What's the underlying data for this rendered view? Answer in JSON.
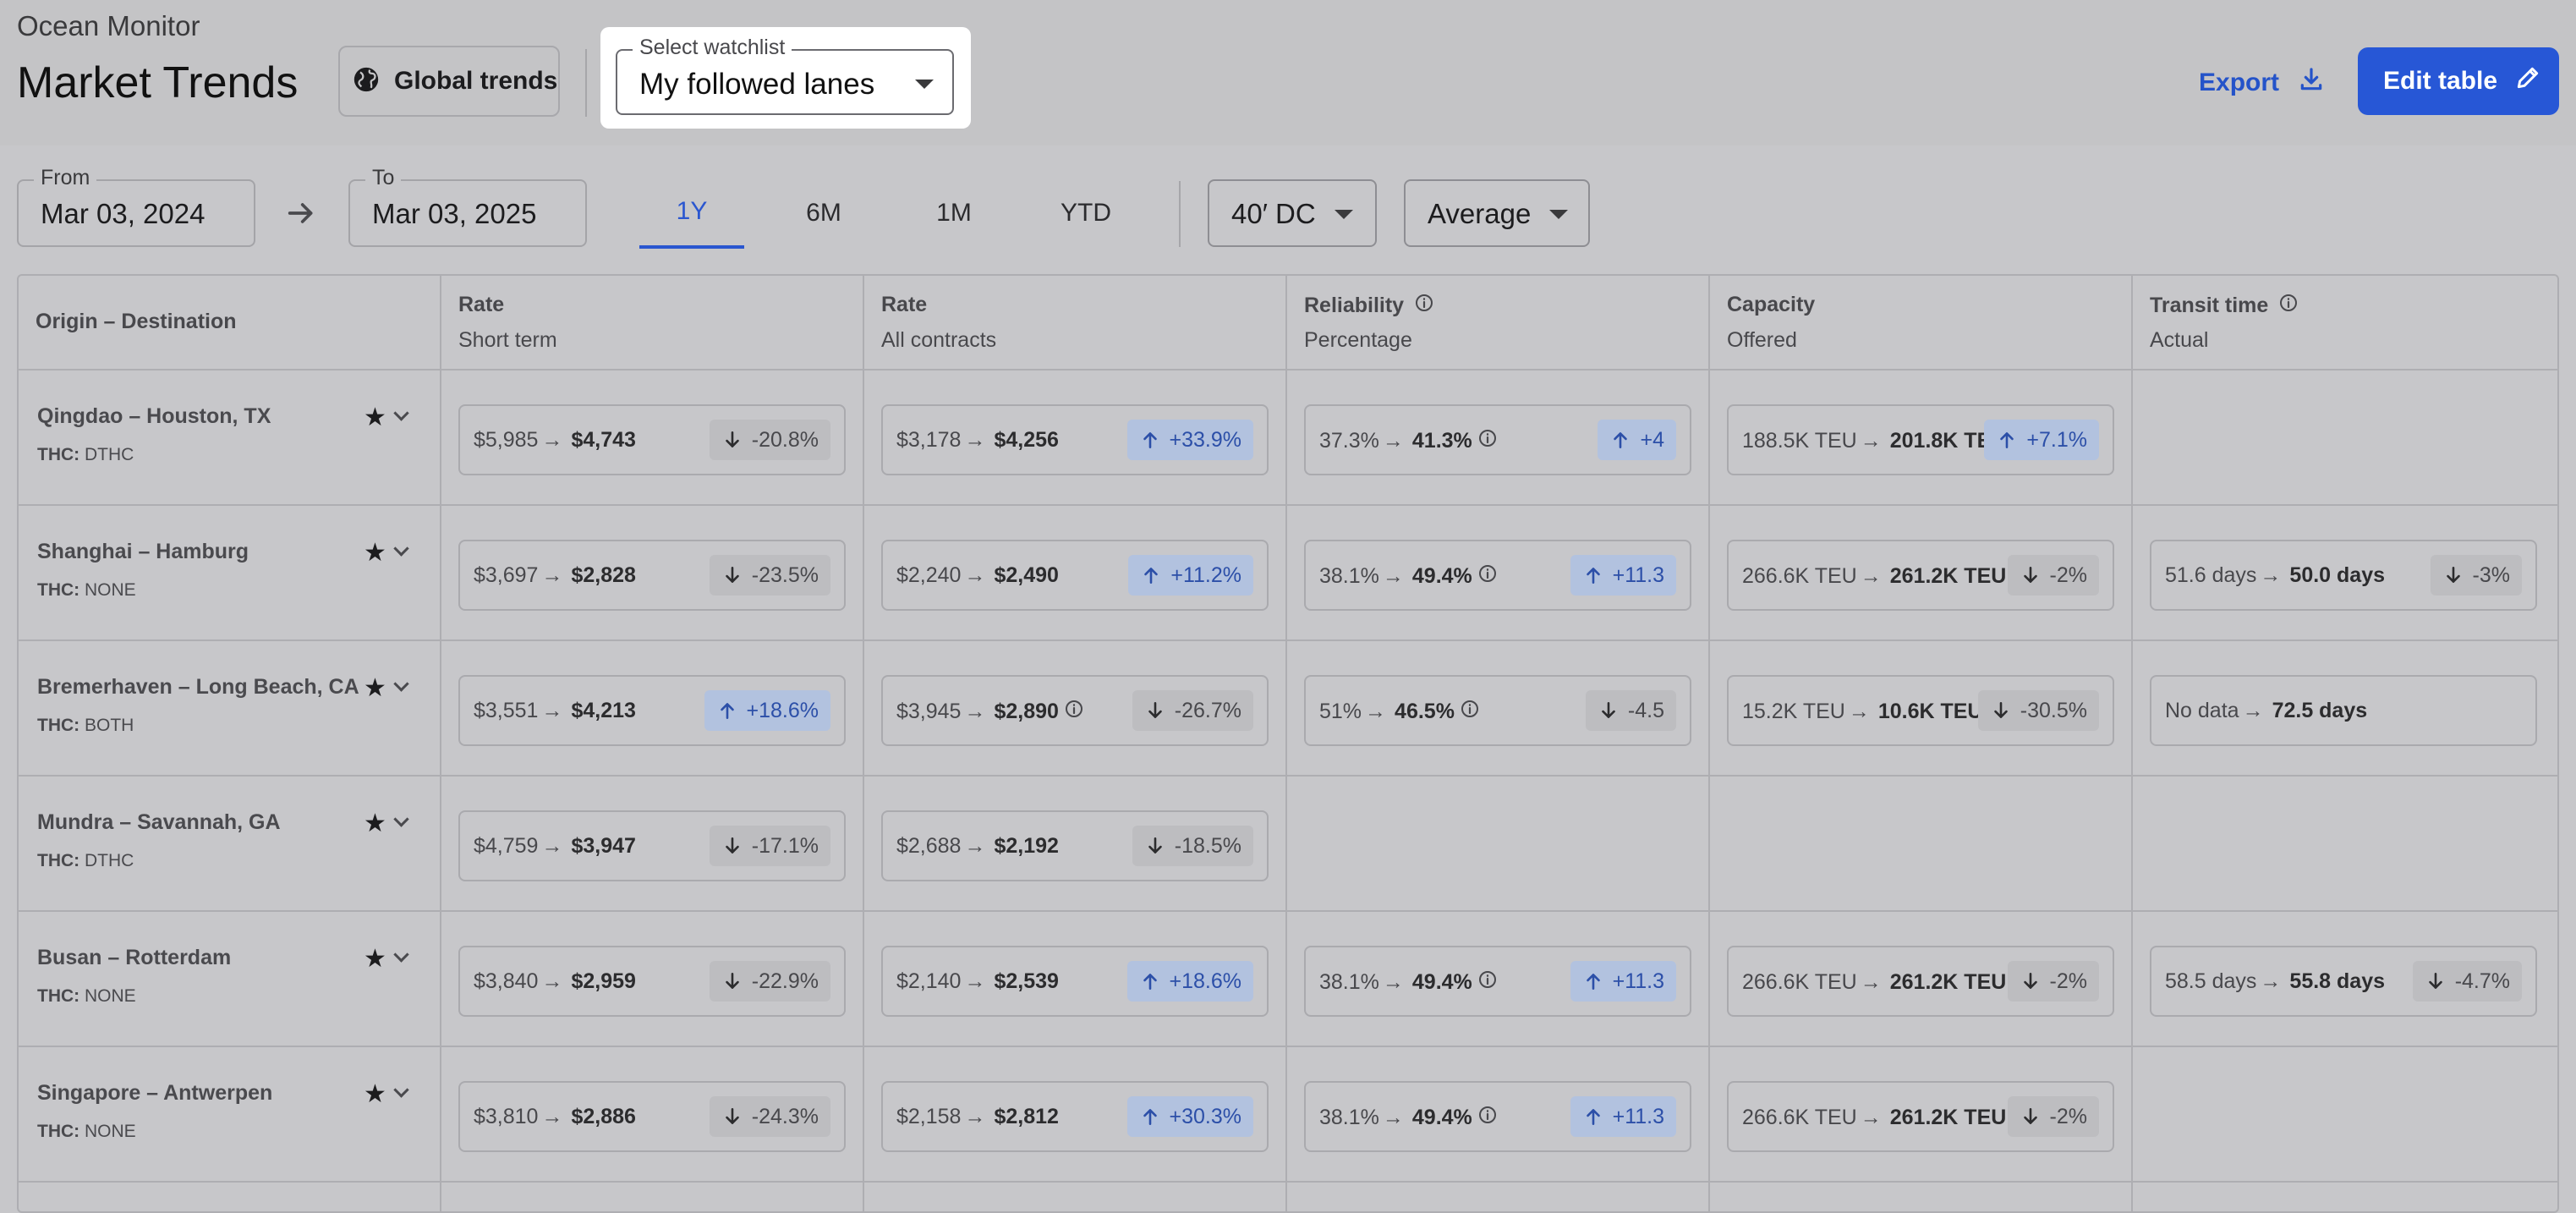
{
  "header": {
    "app_name": "Ocean Monitor",
    "title": "Market Trends",
    "global_trends_label": "Global trends",
    "watchlist_label": "Select watchlist",
    "watchlist_value": "My followed lanes",
    "export_label": "Export",
    "edit_label": "Edit table"
  },
  "filters": {
    "from_label": "From",
    "from_value": "Mar 03, 2024",
    "to_label": "To",
    "to_value": "Mar 03, 2025",
    "tabs": [
      "1Y",
      "6M",
      "1M",
      "YTD"
    ],
    "active_tab": "1Y",
    "container": "40′ DC",
    "aggregation": "Average"
  },
  "columns": {
    "lane": "Origin – Destination",
    "rate_st": {
      "title": "Rate",
      "sub": "Short term"
    },
    "rate_all": {
      "title": "Rate",
      "sub": "All contracts"
    },
    "reliability": {
      "title": "Reliability",
      "sub": "Percentage"
    },
    "capacity": {
      "title": "Capacity",
      "sub": "Offered"
    },
    "transit": {
      "title": "Transit time",
      "sub": "Actual"
    }
  },
  "thc_prefix": "THC:",
  "rows": [
    {
      "name": "Qingdao – Houston, TX",
      "thc": "DTHC",
      "rate_st": {
        "from": "$5,985",
        "to": "$4,743",
        "change": "-20.8%",
        "dir": "down"
      },
      "rate_all": {
        "from": "$3,178",
        "to": "$4,256",
        "change": "+33.9%",
        "dir": "up"
      },
      "reliability": {
        "from": "37.3%",
        "to": "41.3%",
        "change": "+4",
        "dir": "up"
      },
      "capacity": {
        "from": "188.5K TEU",
        "to": "201.8K TEU",
        "change": "+7.1%",
        "dir": "up"
      }
    },
    {
      "name": "Shanghai – Hamburg",
      "thc": "NONE",
      "rate_st": {
        "from": "$3,697",
        "to": "$2,828",
        "change": "-23.5%",
        "dir": "down"
      },
      "rate_all": {
        "from": "$2,240",
        "to": "$2,490",
        "change": "+11.2%",
        "dir": "up"
      },
      "reliability": {
        "from": "38.1%",
        "to": "49.4%",
        "change": "+11.3",
        "dir": "up"
      },
      "capacity": {
        "from": "266.6K TEU",
        "to": "261.2K TEU",
        "change": "-2%",
        "dir": "down"
      },
      "transit": {
        "from": "51.6 days",
        "to": "50.0 days",
        "change": "-3%",
        "dir": "down"
      }
    },
    {
      "name": "Bremerhaven – Long Beach, CA",
      "thc": "BOTH",
      "rate_st": {
        "from": "$3,551",
        "to": "$4,213",
        "change": "+18.6%",
        "dir": "up"
      },
      "rate_all": {
        "from": "$3,945",
        "to": "$2,890",
        "change": "-26.7%",
        "dir": "down"
      },
      "reliability": {
        "from": "51%",
        "to": "46.5%",
        "change": "-4.5",
        "dir": "down"
      },
      "capacity": {
        "from": "15.2K TEU",
        "to": "10.6K TEU",
        "change": "-30.5%",
        "dir": "down"
      },
      "transit": {
        "from": "No data",
        "to": "72.5 days"
      }
    },
    {
      "name": "Mundra – Savannah, GA",
      "thc": "DTHC",
      "rate_st": {
        "from": "$4,759",
        "to": "$3,947",
        "change": "-17.1%",
        "dir": "down"
      },
      "rate_all": {
        "from": "$2,688",
        "to": "$2,192",
        "change": "-18.5%",
        "dir": "down"
      }
    },
    {
      "name": "Busan – Rotterdam",
      "thc": "NONE",
      "rate_st": {
        "from": "$3,840",
        "to": "$2,959",
        "change": "-22.9%",
        "dir": "down"
      },
      "rate_all": {
        "from": "$2,140",
        "to": "$2,539",
        "change": "+18.6%",
        "dir": "up"
      },
      "reliability": {
        "from": "38.1%",
        "to": "49.4%",
        "change": "+11.3",
        "dir": "up"
      },
      "capacity": {
        "from": "266.6K TEU",
        "to": "261.2K TEU",
        "change": "-2%",
        "dir": "down"
      },
      "transit": {
        "from": "58.5 days",
        "to": "55.8 days",
        "change": "-4.7%",
        "dir": "down"
      }
    },
    {
      "name": "Singapore – Antwerpen",
      "thc": "NONE",
      "rate_st": {
        "from": "$3,810",
        "to": "$2,886",
        "change": "-24.3%",
        "dir": "down"
      },
      "rate_all": {
        "from": "$2,158",
        "to": "$2,812",
        "change": "+30.3%",
        "dir": "up"
      },
      "reliability": {
        "from": "38.1%",
        "to": "49.4%",
        "change": "+11.3",
        "dir": "up"
      },
      "capacity": {
        "from": "266.6K TEU",
        "to": "261.2K TEU",
        "change": "-2%",
        "dir": "down"
      }
    }
  ]
}
